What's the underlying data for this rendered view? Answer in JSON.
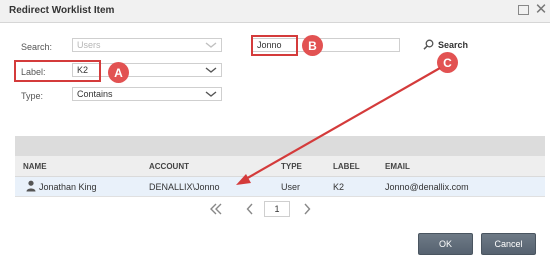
{
  "window": {
    "title": "Redirect Worklist Item"
  },
  "form": {
    "search_label": "Search:",
    "search_placeholder": "Users",
    "label_label": "Label:",
    "label_value": "K2",
    "type_label": "Type:",
    "type_value": "Contains",
    "query_value": "Jonno",
    "search_button": "Search"
  },
  "annotations": {
    "a": "A",
    "b": "B",
    "c": "C",
    "color": "#d43b3b"
  },
  "grid": {
    "columns": [
      "NAME",
      "ACCOUNT",
      "TYPE",
      "LABEL",
      "EMAIL"
    ],
    "rows": [
      {
        "name": "Jonathan King",
        "account": "DENALLIX\\Jonno",
        "type": "User",
        "label": "K2",
        "email": "Jonno@denallix.com"
      }
    ]
  },
  "pager": {
    "page": "1"
  },
  "buttons": {
    "ok": "OK",
    "cancel": "Cancel"
  }
}
